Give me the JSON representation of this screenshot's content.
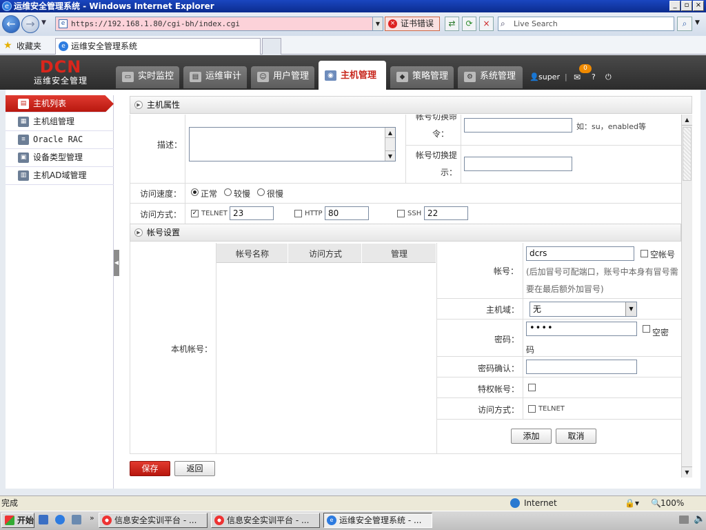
{
  "window": {
    "title": "运维安全管理系统 - Windows Internet Explorer"
  },
  "browser": {
    "url": "https://192.168.1.80/cgi-bh/index.cgi",
    "cert_error": "证书错误",
    "search_placeholder": "Live Search",
    "favorites": "收藏夹",
    "tab_title": "运维安全管理系统"
  },
  "app": {
    "logo_main": "DCN",
    "logo_sub": "运维安全管理",
    "menu": [
      {
        "label": "实时监控"
      },
      {
        "label": "运维审计"
      },
      {
        "label": "用户管理"
      },
      {
        "label": "主机管理",
        "active": true
      },
      {
        "label": "策略管理"
      },
      {
        "label": "系统管理"
      }
    ],
    "user": "super",
    "badge": "0"
  },
  "sidebar": {
    "items": [
      {
        "label": "主机列表"
      },
      {
        "label": "主机组管理"
      },
      {
        "label": "Oracle RAC"
      },
      {
        "label": "设备类型管理"
      },
      {
        "label": "主机AD域管理"
      }
    ]
  },
  "host_props": {
    "title": "主机属性",
    "desc_label": "描述：",
    "switch_cmd_label_1": "帐号切换命",
    "switch_cmd_label_2": "令：",
    "switch_cmd_hint": "如：su，enabled等",
    "switch_prompt_label_1": "帐号切换提",
    "switch_prompt_label_2": "示：",
    "speed_label": "访问速度：",
    "speed_options": [
      "正常",
      "较慢",
      "很慢"
    ],
    "access_label": "访问方式：",
    "telnet": {
      "label": "TELNET",
      "port": "23"
    },
    "http": {
      "label": "HTTP",
      "port": "80"
    },
    "ssh": {
      "label": "SSH",
      "port": "22"
    }
  },
  "account": {
    "title": "帐号设置",
    "local_label": "本机帐号：",
    "columns": [
      "帐号名称",
      "访问方式",
      "管理"
    ],
    "account_label": "帐号：",
    "account_value": "dcrs",
    "empty_account": "空帐号",
    "account_hint": "(后加冒号可配端口，账号中本身有冒号需要在最后额外加冒号)",
    "domain_label": "主机域：",
    "domain_value": "无",
    "password_label": "密码：",
    "password_value": "••••",
    "empty_password": "空密码",
    "password_confirm_label": "密码确认：",
    "privileged_label": "特权帐号：",
    "access_label": "访问方式：",
    "access_option": "TELNET",
    "add_button": "添加",
    "cancel_button": "取消"
  },
  "actions": {
    "save": "保存",
    "back": "返回"
  },
  "status": {
    "text": "完成",
    "zone": "Internet",
    "zoom": "100%"
  },
  "taskbar": {
    "start": "开始",
    "tasks": [
      "信息安全实训平台 - ...",
      "信息安全实训平台 - ...",
      "运维安全管理系统 - ..."
    ]
  }
}
